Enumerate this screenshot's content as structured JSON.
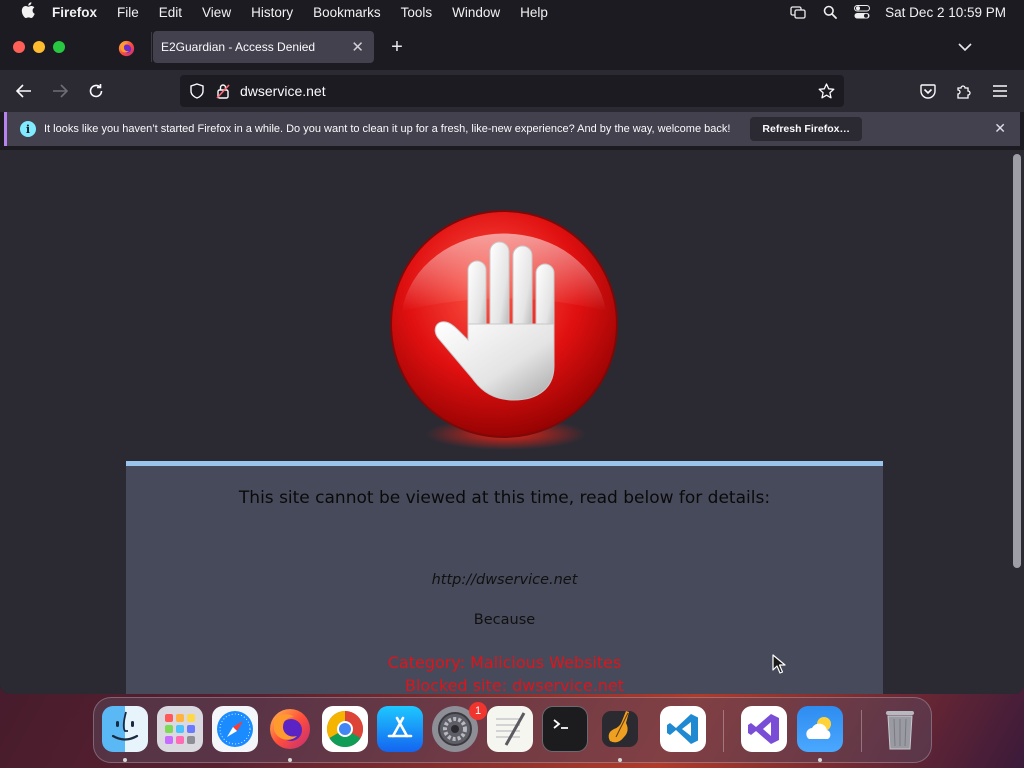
{
  "menubar": {
    "app_name": "Firefox",
    "items": [
      "File",
      "Edit",
      "View",
      "History",
      "Bookmarks",
      "Tools",
      "Window",
      "Help"
    ],
    "datetime": "Sat Dec 2  10:59 PM"
  },
  "browser": {
    "tab_title": "E2Guardian - Access Denied",
    "url": "dwservice.net",
    "notification": {
      "message": "It looks like you haven’t started Firefox in a while. Do you want to clean it up for a fresh, like-new experience? And by the way, welcome back!",
      "button": "Refresh Firefox…"
    }
  },
  "page": {
    "heading": "This site cannot be viewed at this time, read below for details:",
    "blocked_url": "http://dwservice.net",
    "because": "Because",
    "category": "Category: Malicious Websites",
    "blocked_site": "Blocked site: dwservice.net"
  },
  "dock": {
    "apps": [
      "Finder",
      "Launchpad",
      "Safari",
      "Firefox",
      "Google Chrome",
      "App Store",
      "System Settings",
      "TextEdit",
      "Terminal",
      "GarageBand",
      "Visual Studio Code",
      "Visual Studio",
      "Weather",
      "Trash"
    ],
    "system_settings_badge": "1"
  },
  "colors": {
    "accent_red": "#e0141a",
    "panel_top_border": "#99c4ee",
    "notification_accent": "#b883ef"
  }
}
